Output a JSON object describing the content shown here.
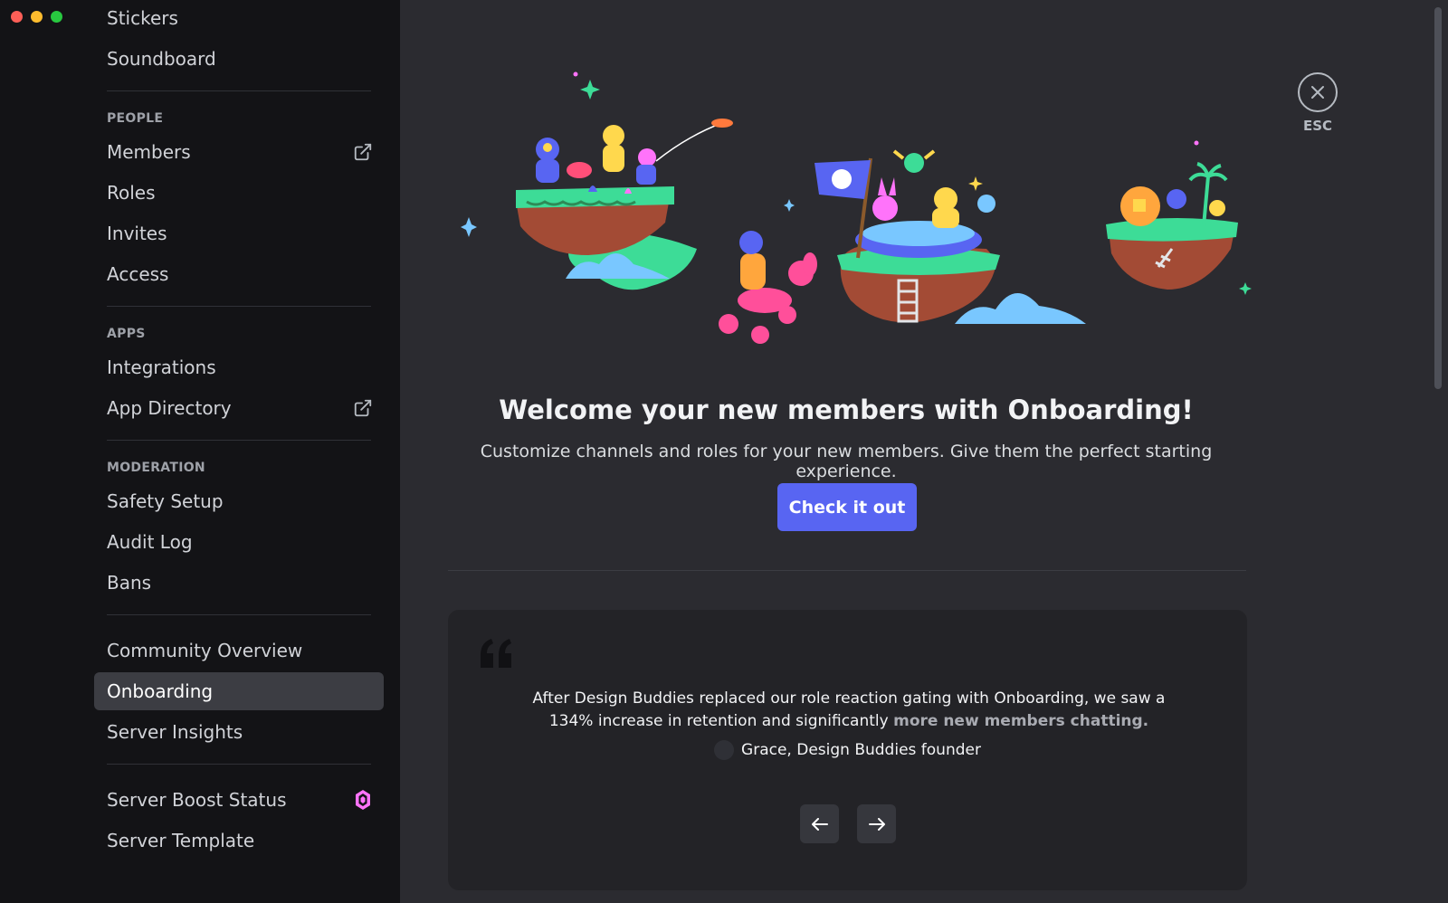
{
  "sidebar": {
    "group_top": [
      {
        "label": "Stickers"
      },
      {
        "label": "Soundboard"
      }
    ],
    "people": {
      "header": "PEOPLE",
      "items": [
        {
          "label": "Members",
          "icon": "external-link-icon"
        },
        {
          "label": "Roles"
        },
        {
          "label": "Invites"
        },
        {
          "label": "Access"
        }
      ]
    },
    "apps": {
      "header": "APPS",
      "items": [
        {
          "label": "Integrations"
        },
        {
          "label": "App Directory",
          "icon": "external-link-icon"
        }
      ]
    },
    "moderation": {
      "header": "MODERATION",
      "items": [
        {
          "label": "Safety Setup"
        },
        {
          "label": "Audit Log"
        },
        {
          "label": "Bans"
        }
      ]
    },
    "community": {
      "items": [
        {
          "label": "Community Overview"
        },
        {
          "label": "Onboarding",
          "selected": true
        },
        {
          "label": "Server Insights"
        }
      ]
    },
    "boost": {
      "items": [
        {
          "label": "Server Boost Status",
          "icon": "boost-gem-icon"
        },
        {
          "label": "Server Template"
        }
      ]
    }
  },
  "close": {
    "label": "ESC"
  },
  "main": {
    "title": "Welcome your new members with Onboarding!",
    "subtitle": "Customize channels and roles for your new members. Give them the perfect starting experience.",
    "cta_label": "Check it out"
  },
  "testimonial": {
    "quote_before": "After Design Buddies replaced our role reaction gating with Onboarding, we saw a 134% increase in retention and significantly ",
    "quote_link": "more new members chatting.",
    "author": "Grace, Design Buddies founder"
  },
  "colors": {
    "sidebar_bg": "#131316",
    "main_bg": "#2b2b30",
    "accent": "#5865f2",
    "boost_pink": "#ff73fa"
  }
}
